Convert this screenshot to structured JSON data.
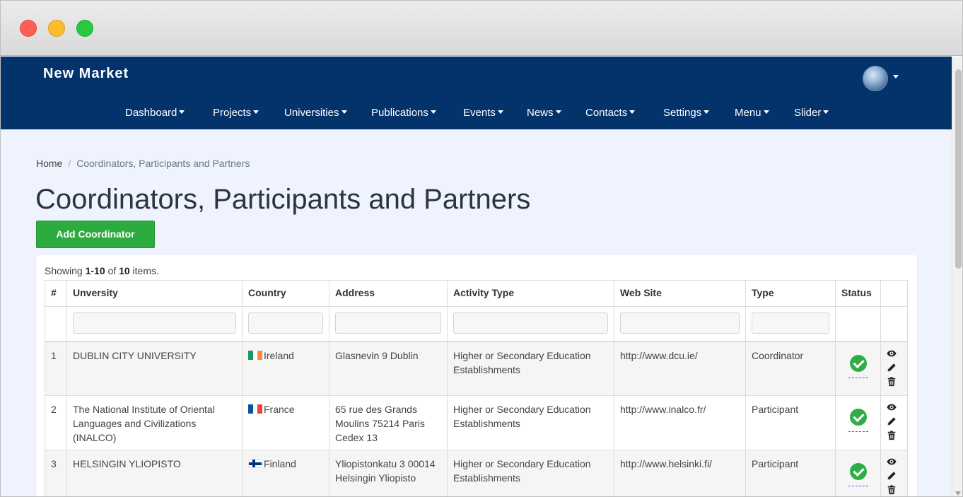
{
  "window": {
    "controls": [
      "close",
      "minimize",
      "maximize"
    ]
  },
  "navbar": {
    "brand": "New Market",
    "menu": [
      {
        "label": "Dashboard"
      },
      {
        "label": "Projects"
      },
      {
        "label": "Universities"
      },
      {
        "label": "Publications"
      },
      {
        "label": "Events"
      },
      {
        "label": "News"
      },
      {
        "label": "Contacts"
      },
      {
        "label": "Settings"
      },
      {
        "label": "Menu"
      },
      {
        "label": "Slider"
      }
    ],
    "background_color": "#04336b"
  },
  "breadcrumb": {
    "home": "Home",
    "separator": "/",
    "current": "Coordinators, Participants and Partners"
  },
  "page": {
    "title": "Coordinators, Participants and Partners",
    "add_button": "Add Coordinator",
    "add_button_color": "#2cab3f"
  },
  "grid": {
    "summary_prefix": "Showing ",
    "summary_range": "1-10",
    "summary_mid": " of ",
    "summary_total": "10",
    "summary_suffix": " items.",
    "headers": [
      "#",
      "Unversity",
      "Country",
      "Address",
      "Activity Type",
      "Web Site",
      "Type",
      "Status",
      ""
    ],
    "rows": [
      {
        "num": "1",
        "university": "DUBLIN CITY UNIVERSITY",
        "country": "Ireland",
        "flag": "ireland-flag",
        "address": "Glasnevin 9 Dublin",
        "activity_type": "Higher or Secondary Education Establishments",
        "web_site": "http://www.dcu.ie/",
        "type": "Coordinator",
        "status": "active"
      },
      {
        "num": "2",
        "university": "The National Institute of Oriental Languages and Civilizations (INALCO)",
        "country": "France",
        "flag": "france-flag",
        "address": "65 rue des Grands Moulins 75214 Paris Cedex 13",
        "activity_type": "Higher or Secondary Education Establishments",
        "web_site": "http://www.inalco.fr/",
        "type": "Participant",
        "status": "active"
      },
      {
        "num": "3",
        "university": "HELSINGIN YLIOPISTO",
        "country": "Finland",
        "flag": "finland-flag",
        "address": "Yliopistonkatu 3 00014 Helsingin Yliopisto",
        "activity_type": "Higher or Secondary Education Establishments",
        "web_site": "http://www.helsinki.fi/",
        "type": "Participant",
        "status": "active"
      }
    ]
  }
}
